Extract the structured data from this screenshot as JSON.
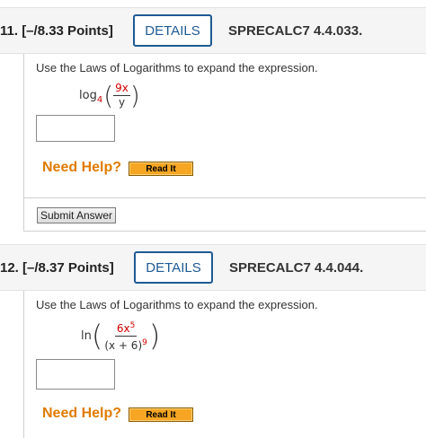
{
  "questions": [
    {
      "number_points": "11. [–/8.33 Points]",
      "details_label": "DETAILS",
      "code": "SPRECALC7 4.4.033.",
      "prompt": "Use the Laws of Logarithms to expand the expression.",
      "expression": {
        "func": "log",
        "base": "4",
        "numerator": "9x",
        "denominator": "y"
      },
      "answer_value": "",
      "need_help": "Need Help?",
      "read_it": "Read It",
      "submit_label": "Submit Answer"
    },
    {
      "number_points": "12. [–/8.37 Points]",
      "details_label": "DETAILS",
      "code": "SPRECALC7 4.4.044.",
      "prompt": "Use the Laws of Logarithms to expand the expression.",
      "expression": {
        "func": "ln",
        "numerator_coef": "6",
        "numerator_var": "x",
        "numerator_exp": "5",
        "denominator_base": "(x + 6)",
        "denominator_exp": "9"
      },
      "answer_value": "",
      "need_help": "Need Help?",
      "read_it": "Read It"
    }
  ],
  "colors": {
    "details_border": "#1f5a94",
    "need_help": "#e07b00",
    "read_it_bg": "#f6a623",
    "math_highlight": "#d00000"
  }
}
